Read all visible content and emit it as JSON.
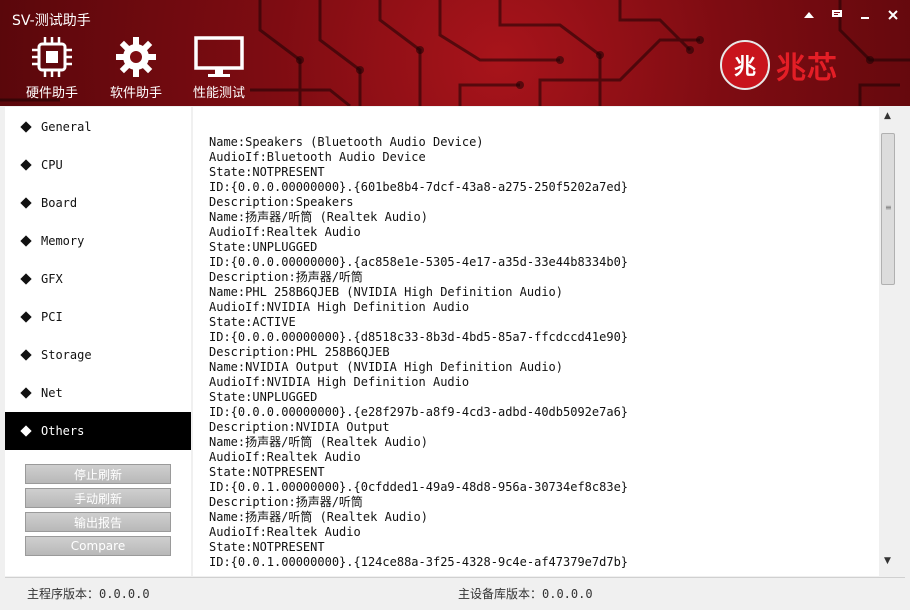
{
  "app": {
    "title": "SV-测试助手"
  },
  "window_controls": [
    {
      "name": "skin-icon"
    },
    {
      "name": "chat-icon"
    },
    {
      "name": "minimize-icon"
    },
    {
      "name": "close-icon"
    }
  ],
  "toolbar": [
    {
      "label": "硬件助手",
      "icon": "chip-icon"
    },
    {
      "label": "软件助手",
      "icon": "gear-icon"
    },
    {
      "label": "性能测试",
      "icon": "monitor-icon"
    }
  ],
  "brand": {
    "logo_glyph": "兆",
    "text": "兆芯"
  },
  "sidebar": {
    "items": [
      {
        "label": "General",
        "active": false
      },
      {
        "label": "CPU",
        "active": false
      },
      {
        "label": "Board",
        "active": false
      },
      {
        "label": "Memory",
        "active": false
      },
      {
        "label": "GFX",
        "active": false
      },
      {
        "label": "PCI",
        "active": false
      },
      {
        "label": "Storage",
        "active": false
      },
      {
        "label": "Net",
        "active": false
      },
      {
        "label": "Others",
        "active": true
      }
    ],
    "buttons": [
      "停止刷新",
      "手动刷新",
      "输出报告",
      "Compare"
    ]
  },
  "content": {
    "lines": [
      "Name:Speakers (Bluetooth Audio Device)",
      "AudioIf:Bluetooth Audio Device",
      "State:NOTPRESENT",
      "ID:{0.0.0.00000000}.{601be8b4-7dcf-43a8-a275-250f5202a7ed}",
      "Description:Speakers",
      "Name:扬声器/听筒 (Realtek Audio)",
      "AudioIf:Realtek Audio",
      "State:UNPLUGGED",
      "ID:{0.0.0.00000000}.{ac858e1e-5305-4e17-a35d-33e44b8334b0}",
      "Description:扬声器/听筒",
      "Name:PHL 258B6QJEB (NVIDIA High Definition Audio)",
      "AudioIf:NVIDIA High Definition Audio",
      "State:ACTIVE",
      "ID:{0.0.0.00000000}.{d8518c33-8b3d-4bd5-85a7-ffcdccd41e90}",
      "Description:PHL 258B6QJEB",
      "Name:NVIDIA Output (NVIDIA High Definition Audio)",
      "AudioIf:NVIDIA High Definition Audio",
      "State:UNPLUGGED",
      "ID:{0.0.0.00000000}.{e28f297b-a8f9-4cd3-adbd-40db5092e7a6}",
      "Description:NVIDIA Output",
      "Name:扬声器/听筒 (Realtek Audio)",
      "AudioIf:Realtek Audio",
      "State:NOTPRESENT",
      "ID:{0.0.1.00000000}.{0cfdded1-49a9-48d8-956a-30734ef8c83e}",
      "Description:扬声器/听筒",
      "Name:扬声器/听筒 (Realtek Audio)",
      "AudioIf:Realtek Audio",
      "State:NOTPRESENT",
      "ID:{0.0.1.00000000}.{124ce88a-3f25-4328-9c4e-af47379e7d7b}"
    ]
  },
  "status": {
    "program_version": "主程序版本：0.0.0.0",
    "device_db_version": "主设备库版本：0.0.0.0"
  }
}
